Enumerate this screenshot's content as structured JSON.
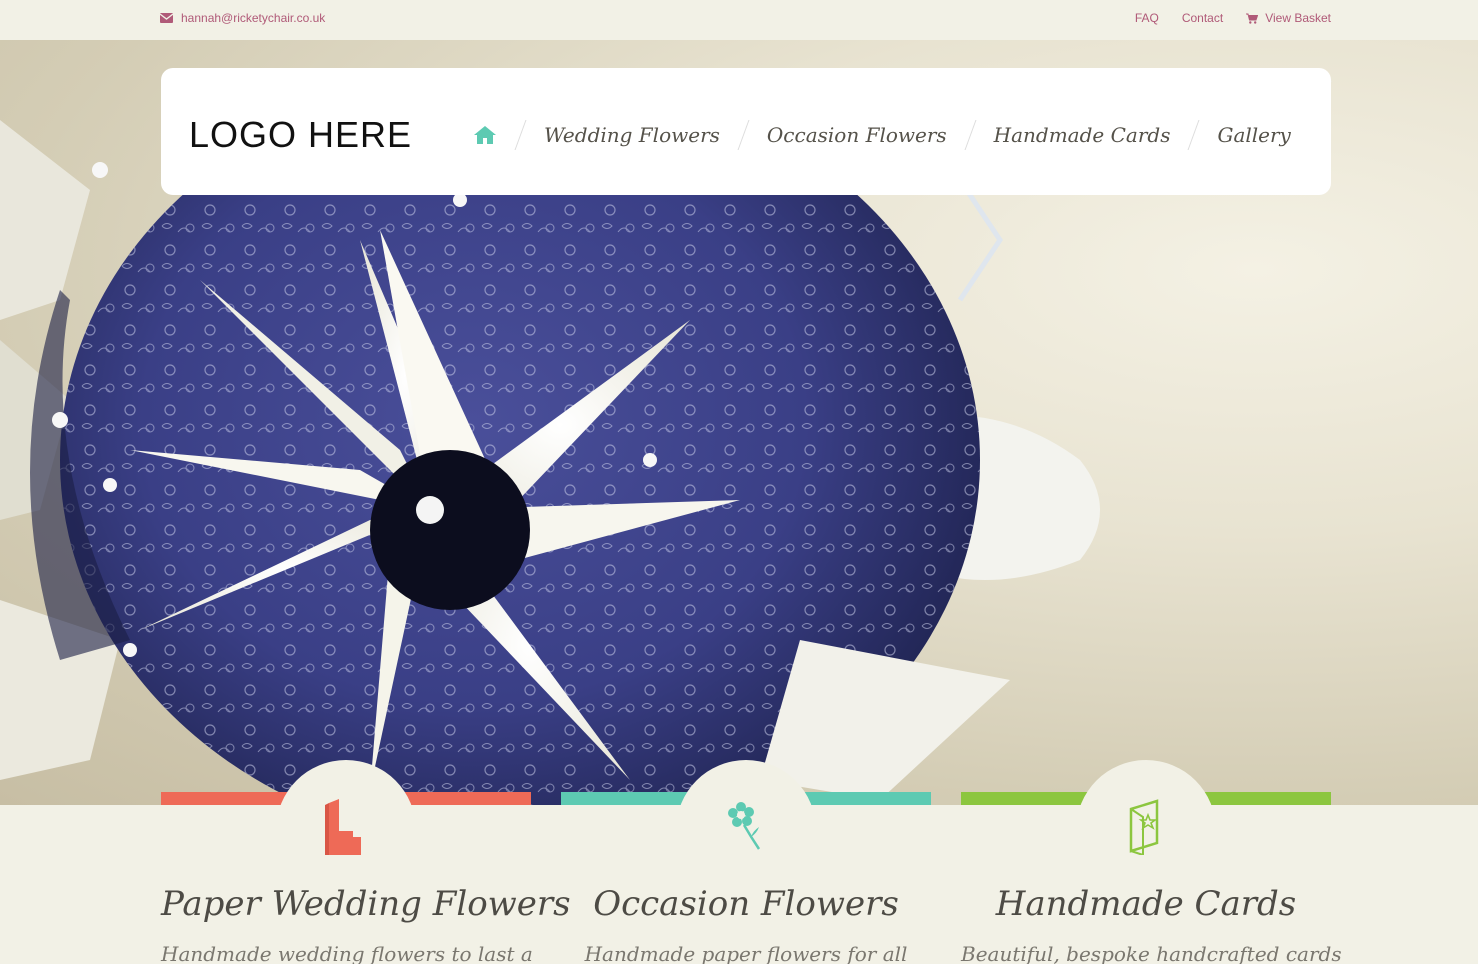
{
  "topbar": {
    "email": "hannah@ricketychair.co.uk",
    "faq": "FAQ",
    "contact": "Contact",
    "basket": "View Basket"
  },
  "header": {
    "logo": "LOGO HERE",
    "nav": [
      "Wedding Flowers",
      "Occasion Flowers",
      "Handmade Cards",
      "Gallery"
    ]
  },
  "features": [
    {
      "title": "Paper Wedding Flowers",
      "desc": "Handmade wedding flowers to last a",
      "color": "#ee6a57",
      "icon": "church-icon"
    },
    {
      "title": "Occasion Flowers",
      "desc": "Handmade paper flowers for all",
      "color": "#5dcab2",
      "icon": "flower-icon"
    },
    {
      "title": "Handmade Cards",
      "desc": "Beautiful, bespoke handcrafted cards",
      "color": "#8cc63f",
      "icon": "card-icon"
    }
  ],
  "colors": {
    "link": "#b05a78",
    "home_icon": "#5dcab2",
    "background": "#f2f1e6"
  }
}
